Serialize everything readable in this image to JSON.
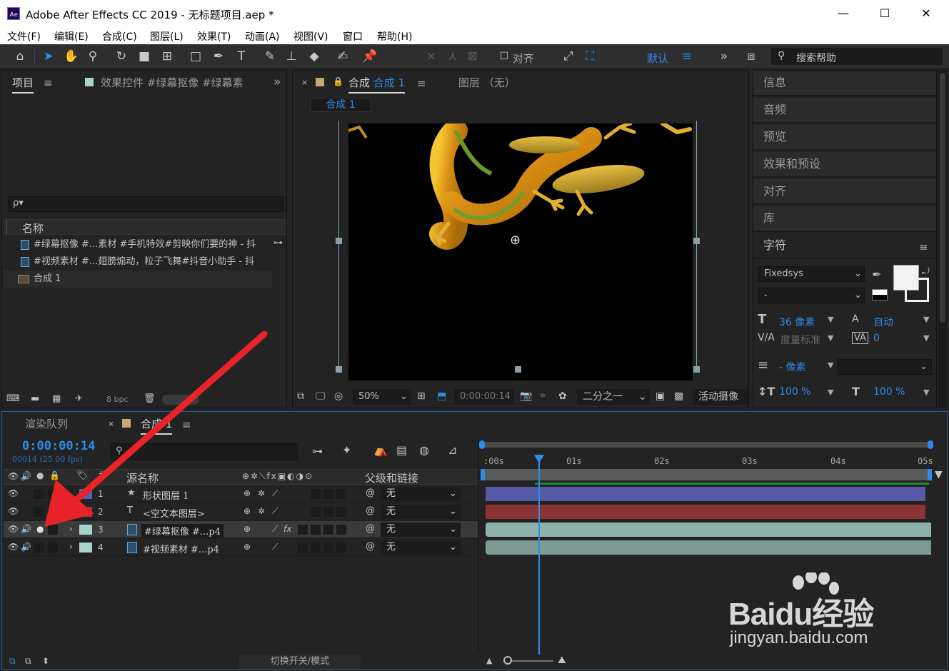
{
  "window": {
    "title": "Adobe After Effects CC 2019 - 无标题项目.aep *",
    "app_icon": "Ae",
    "minimize": "—",
    "maximize": "☐",
    "close": "✕"
  },
  "menu": [
    "文件(F)",
    "编辑(E)",
    "合成(C)",
    "图层(L)",
    "效果(T)",
    "动画(A)",
    "视图(V)",
    "窗口",
    "帮助(H)"
  ],
  "toolbar": {
    "align_label": "对齐",
    "workspace": "默认",
    "search_placeholder": "搜索帮助",
    "icons": [
      "home-icon",
      "selection-tool-icon",
      "hand-tool-icon",
      "zoom-tool-icon",
      "rotate-tool-icon",
      "camera-tool-icon",
      "pan-behind-tool-icon",
      "rectangle-tool-icon",
      "pen-tool-icon",
      "type-tool-icon",
      "brush-tool-icon",
      "clone-stamp-tool-icon",
      "eraser-tool-icon",
      "roto-brush-tool-icon",
      "puppet-pin-tool-icon"
    ]
  },
  "project_panel": {
    "tab_project": "项目",
    "tab_effects": "效果控件 #绿幕抠像 #绿幕素",
    "search_placeholder": "ρ▾",
    "col_name": "名称",
    "items": [
      {
        "name": "#绿幕抠像  #...素材  #手机特效#剪映你们要的神 - 抖",
        "type": "footage"
      },
      {
        "name": "#视频素材  #...翅膀煽动，粒子飞舞#抖音小助手 - 抖",
        "type": "footage"
      },
      {
        "name": "合成 1",
        "type": "composition"
      }
    ],
    "bpc": "8 bpc"
  },
  "comp_panel": {
    "tab_comp_prefix": "合成",
    "tab_comp_name": "合成 1",
    "tab_layer": "图层 （无）",
    "subtab": "合成 1",
    "zoom": "50%",
    "timecode": "0:00:00:14",
    "resolution": "二分之一",
    "camera": "活动摄像"
  },
  "right_panels": {
    "headers": [
      "信息",
      "音频",
      "预览",
      "效果和预设",
      "对齐",
      "库",
      "字符"
    ],
    "character": {
      "font": "Fixedsys",
      "style": "-",
      "size": "36 像素",
      "leading": "自动",
      "kerning": "度量标准",
      "tracking": "0",
      "stroke": "- 像素",
      "vscale": "100 %",
      "hscale": "100 %"
    }
  },
  "timeline": {
    "tab_render": "渲染队列",
    "tab_comp": "合成 1",
    "timecode": "0:00:00:14",
    "fps": "00014 (25.00 fps)",
    "col_source": "源名称",
    "col_parent": "父级和链接",
    "ruler": [
      ":00s",
      "01s",
      "02s",
      "03s",
      "04s",
      "05s"
    ],
    "playhead_fraction": 0.093,
    "layers": [
      {
        "num": "1",
        "icon": "★",
        "name": "形状图层 1",
        "label_color": "#5b5fa8",
        "parent": "无",
        "bar_color": "#575aa6"
      },
      {
        "num": "2",
        "icon": "T",
        "name": "<空文本图层>",
        "label_color": "#b03232",
        "parent": "无",
        "bar_color": "#8a3434"
      },
      {
        "num": "3",
        "icon": "▣",
        "name": "#绿幕抠像 #...p4",
        "label_color": "#a8d4cc",
        "parent": "无",
        "bar_color": "#8fb3ac"
      },
      {
        "num": "4",
        "icon": "▣",
        "name": "#视频素材 #...p4",
        "label_color": "#a8d4cc",
        "parent": "无",
        "bar_color": "#7d9a95"
      }
    ],
    "footer_toggle": "切换开关/模式"
  },
  "watermark": {
    "brand": "Baidu经验",
    "url": "jingyan.baidu.com"
  },
  "colors": {
    "accent_blue": "#2d8ceb",
    "arrow_red": "#e8232a"
  }
}
